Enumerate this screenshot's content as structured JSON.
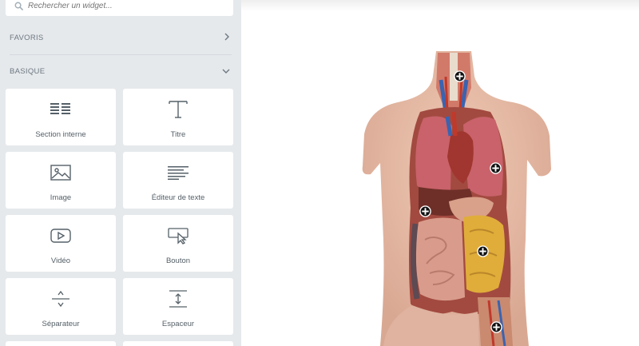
{
  "search": {
    "placeholder": "Rechercher un widget..."
  },
  "sections": {
    "favoris": "FAVORIS",
    "basique": "BASIQUE"
  },
  "widgets": [
    {
      "label": "Section interne",
      "icon": "inner-section-icon"
    },
    {
      "label": "Titre",
      "icon": "heading-icon"
    },
    {
      "label": "Image",
      "icon": "image-icon"
    },
    {
      "label": "Éditeur de texte",
      "icon": "text-editor-icon"
    },
    {
      "label": "Vidéo",
      "icon": "video-icon"
    },
    {
      "label": "Bouton",
      "icon": "button-icon"
    },
    {
      "label": "Séparateur",
      "icon": "divider-icon"
    },
    {
      "label": "Espaceur",
      "icon": "spacer-icon"
    }
  ],
  "canvas": {
    "image": "anatomical-torso-model",
    "hotspot_count": 6
  },
  "colors": {
    "panel_bg": "#e6e9ec",
    "tile_bg": "#ffffff",
    "icon": "#556068",
    "text": "#6d7882"
  }
}
